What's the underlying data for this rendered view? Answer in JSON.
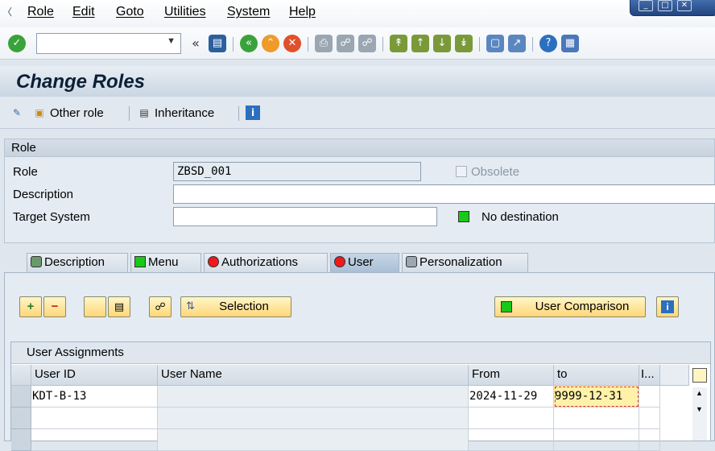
{
  "menu": [
    "Role",
    "Edit",
    "Goto",
    "Utilities",
    "System",
    "Help"
  ],
  "window_controls": [
    "minimize-icon",
    "maximize-icon",
    "close-icon"
  ],
  "toolbar": {
    "command_value": "",
    "icons": [
      "enter-icon",
      "save-icon",
      "back-icon",
      "exit-icon",
      "cancel-icon",
      "print-icon",
      "find-icon",
      "find-next-icon",
      "first-page-icon",
      "previous-page-icon",
      "next-page-icon",
      "last-page-icon",
      "new-session-icon",
      "shortcut-icon",
      "help-icon",
      "customize-layout-icon"
    ]
  },
  "title": "Change Roles",
  "app_toolbar": {
    "other_role": "Other role",
    "inheritance": "Inheritance"
  },
  "role_group": {
    "header": "Role",
    "role_label": "Role",
    "role_value": "ZBSD_001",
    "obsolete_label": "Obsolete",
    "description_label": "Description",
    "description_value": "",
    "target_system_label": "Target System",
    "target_system_value": "",
    "destination_status": "No destination"
  },
  "tabs": [
    {
      "label": "Description",
      "status": "icon"
    },
    {
      "label": "Menu",
      "status": "green"
    },
    {
      "label": "Authorizations",
      "status": "red"
    },
    {
      "label": "User",
      "status": "red",
      "active": true
    },
    {
      "label": "Personalization",
      "status": "icon"
    }
  ],
  "user_tab": {
    "selection_label": "Selection",
    "user_comparison_label": "User Comparison",
    "table_title": "User Assignments",
    "columns": [
      "User ID",
      "User Name",
      "From",
      "to",
      "I..."
    ],
    "rows": [
      {
        "user_id": "KDT-B-13",
        "user_name": "",
        "from": "2024-11-29",
        "to": "9999-12-31"
      },
      {
        "user_id": "",
        "user_name": "",
        "from": "",
        "to": ""
      },
      {
        "user_id": "",
        "user_name": "",
        "from": "",
        "to": ""
      }
    ]
  },
  "colors": {
    "status_green": "#18c918",
    "status_red": "#ef1a1a",
    "button_yellow": "#ffd778",
    "selected_cell": "#fff1a8"
  }
}
